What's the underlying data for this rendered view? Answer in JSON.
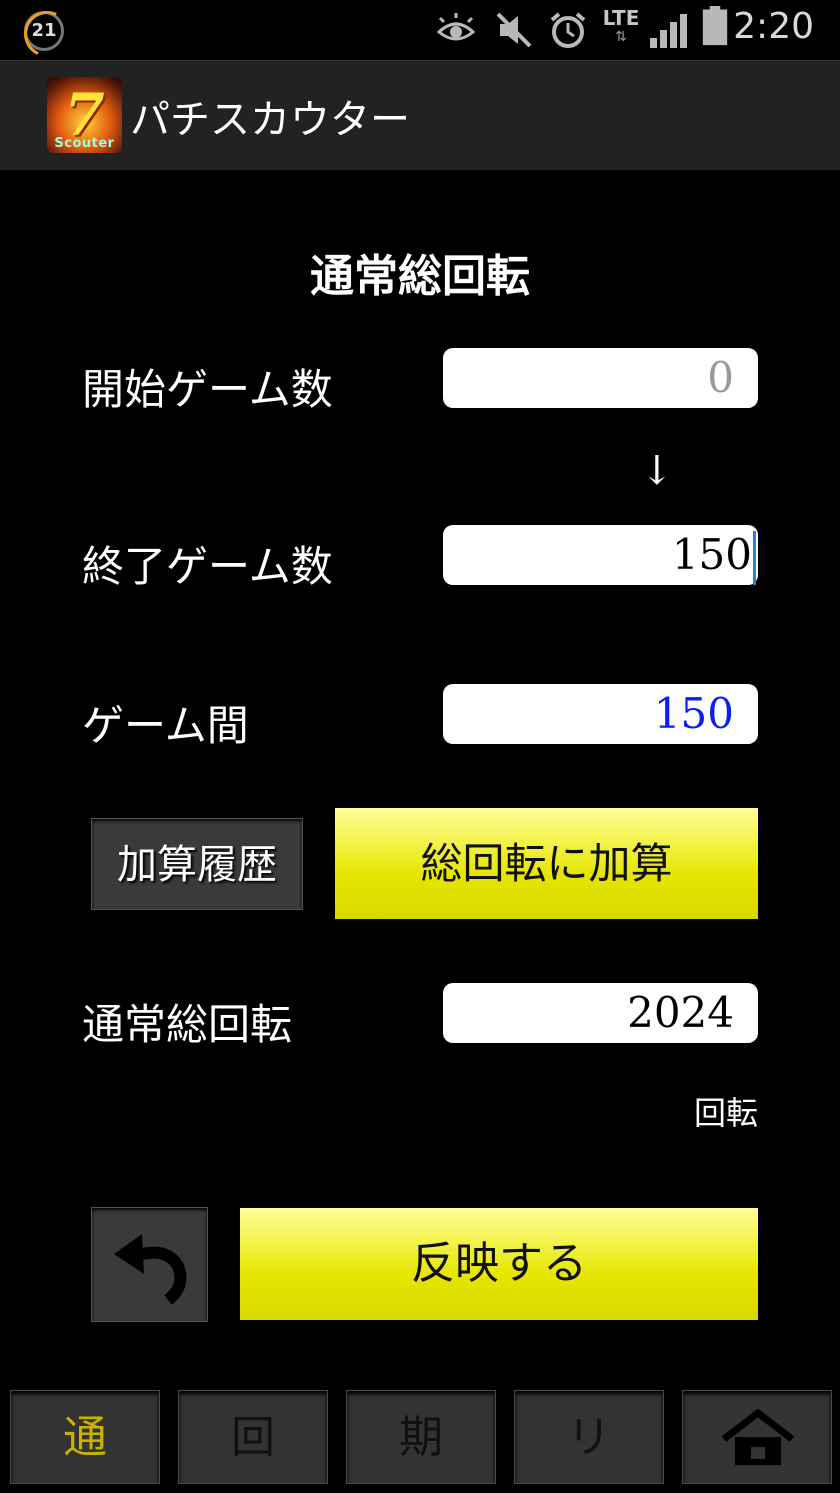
{
  "status_bar": {
    "notification_count": "21",
    "network_label": "LTE",
    "time": "2:20",
    "icons": [
      "eye-icon",
      "mute-icon",
      "alarm-icon",
      "lte-icon",
      "signal-icon",
      "battery-icon"
    ]
  },
  "action_bar": {
    "title": "パチスカウター",
    "logo_seven": "7",
    "logo_text": "Scouter"
  },
  "main": {
    "section_title": "通常総回転",
    "start_label": "開始ゲーム数",
    "start_placeholder": "0",
    "arrow": "↓",
    "end_label": "終了ゲーム数",
    "end_value": "150",
    "diff_label": "ゲーム間",
    "diff_value": "150",
    "history_button": "加算履歴",
    "add_button": "総回転に加算",
    "total_label": "通常総回転",
    "total_value": "2024",
    "total_unit": "回転",
    "apply_button": "反映する"
  },
  "tabs": [
    {
      "label": "通",
      "active": true
    },
    {
      "label": "回",
      "active": false
    },
    {
      "label": "期",
      "active": false
    },
    {
      "label": "リ",
      "active": false
    },
    {
      "label": "",
      "icon": "home-icon",
      "active": false
    }
  ],
  "colors": {
    "accent_yellow": "#e6e600",
    "active_tab": "#c8b400",
    "diff_blue": "#0a1ff0"
  }
}
